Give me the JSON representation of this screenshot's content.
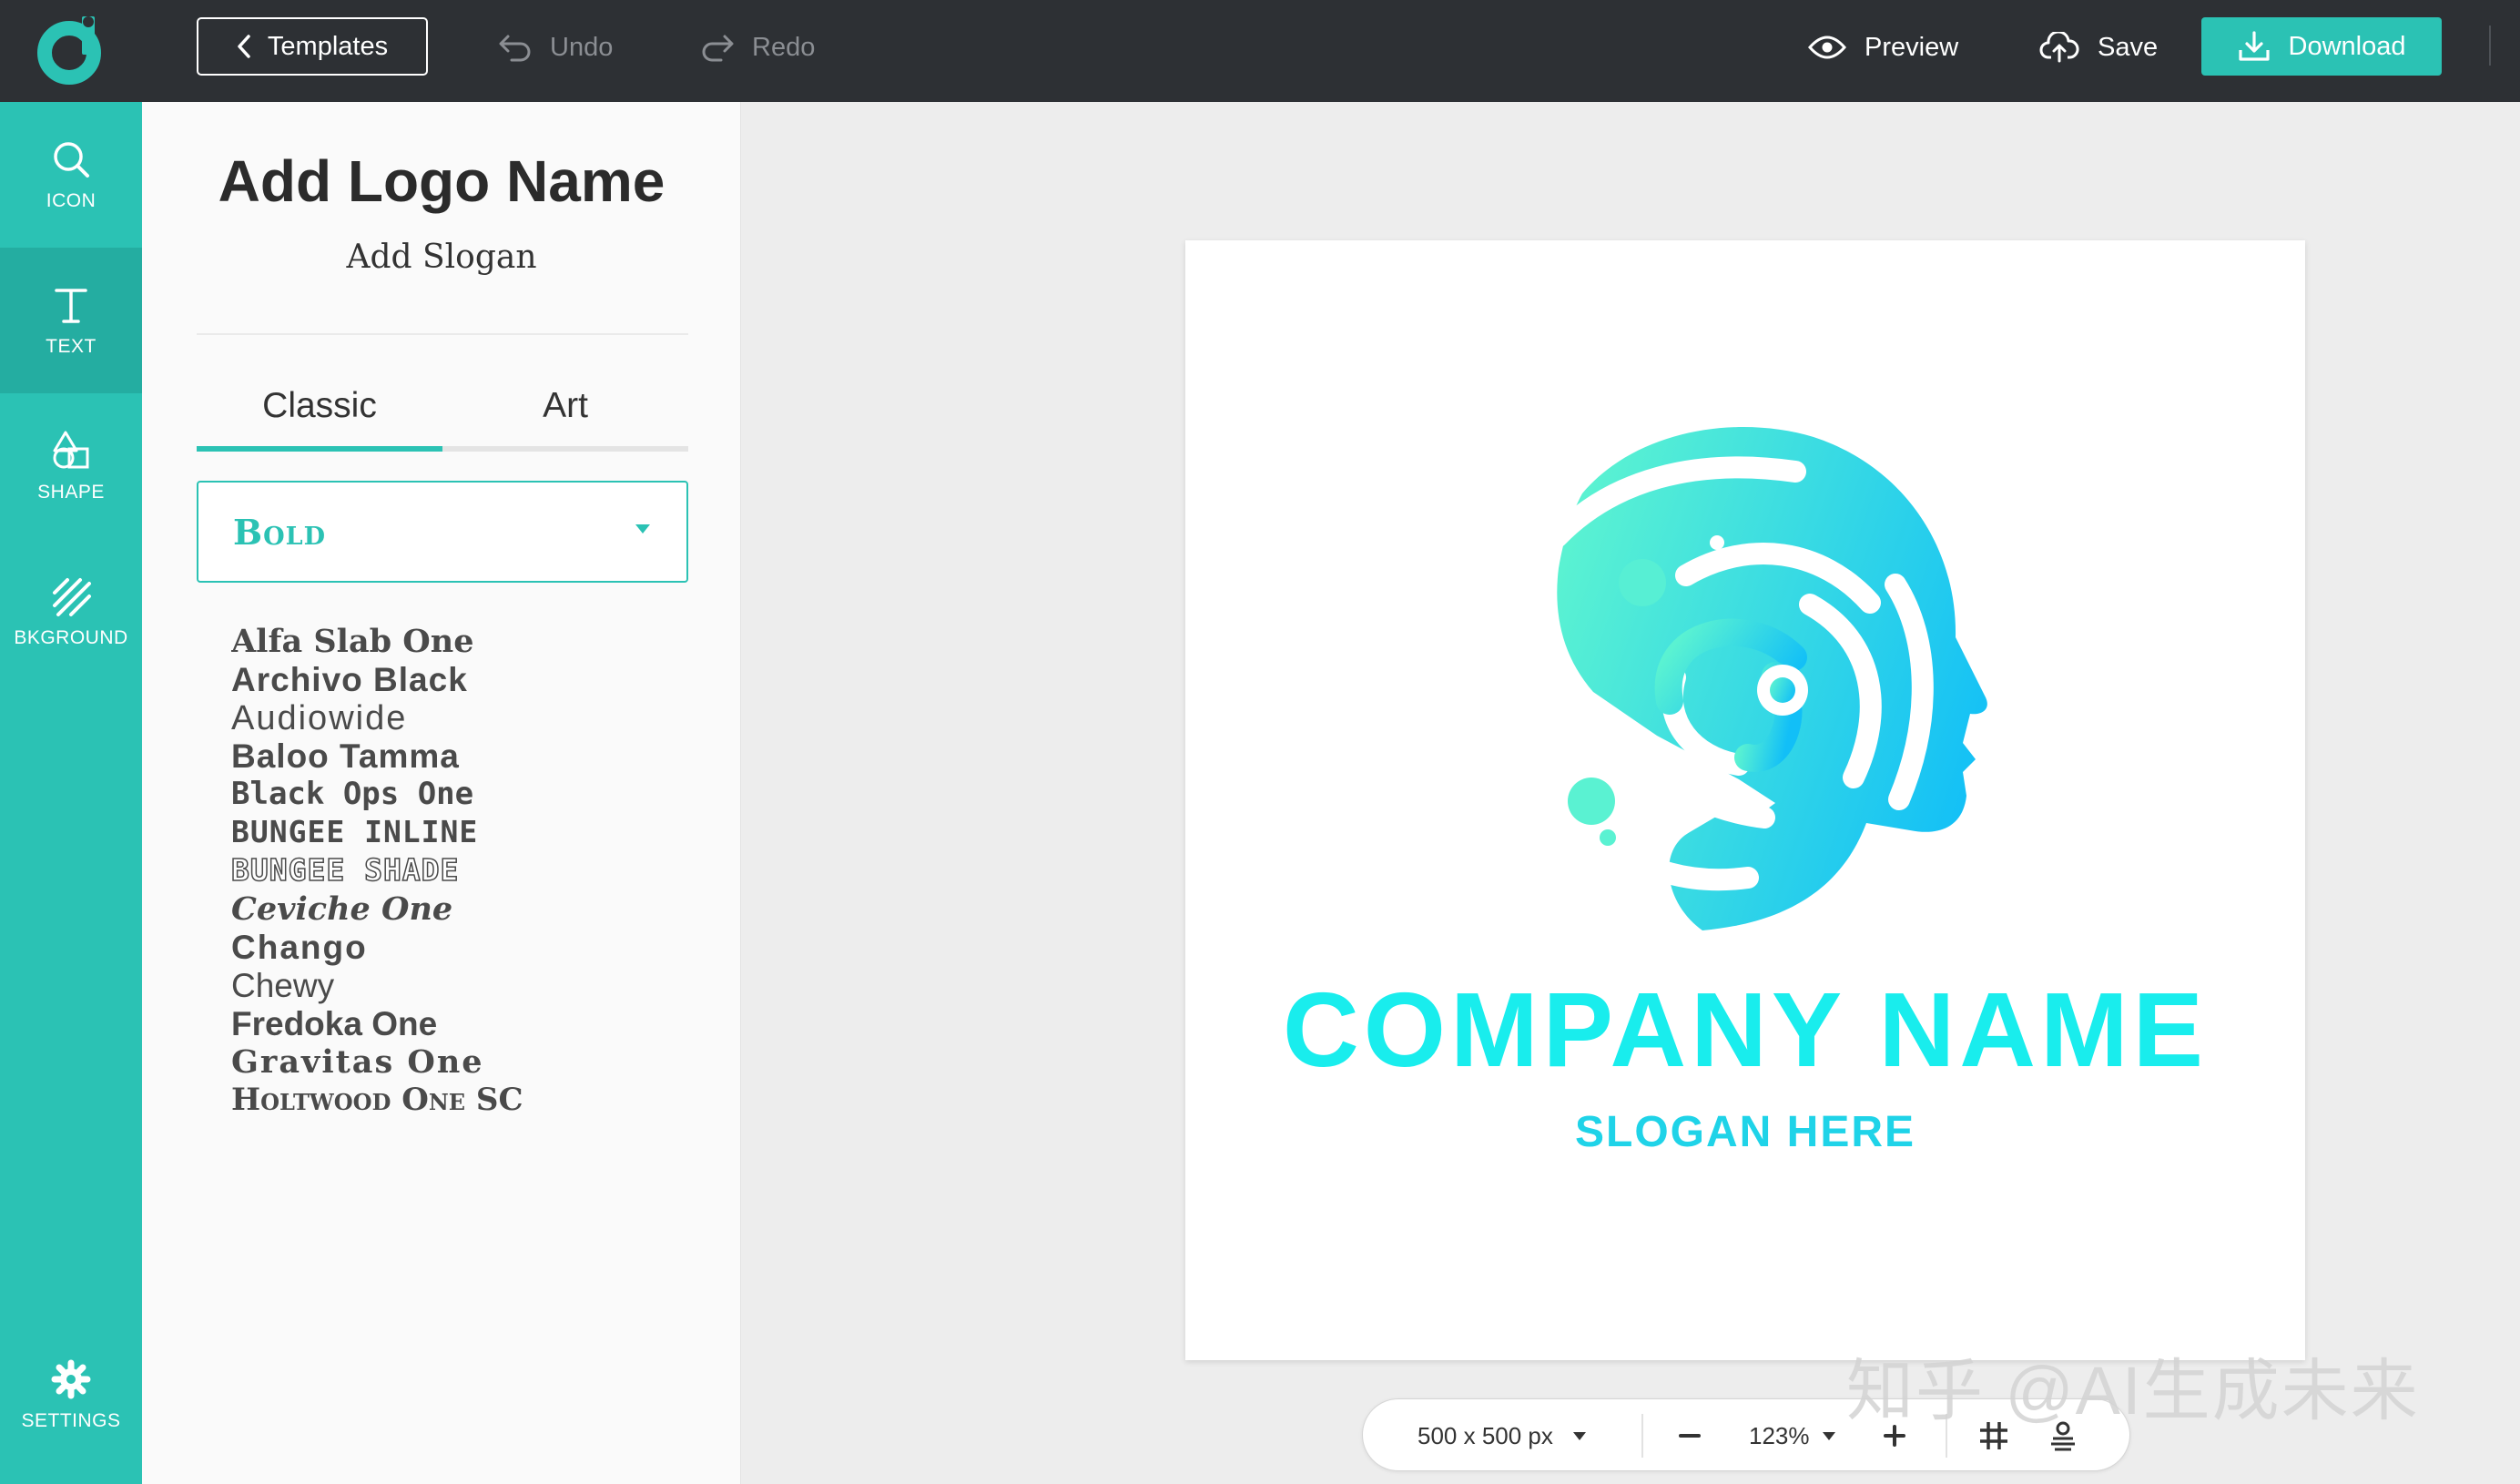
{
  "toolbar": {
    "templates_label": "Templates",
    "undo_label": "Undo",
    "redo_label": "Redo",
    "preview_label": "Preview",
    "save_label": "Save",
    "download_label": "Download"
  },
  "sidebar": {
    "items": [
      {
        "label": "ICON",
        "icon": "search-icon"
      },
      {
        "label": "TEXT",
        "icon": "text-icon"
      },
      {
        "label": "SHAPE",
        "icon": "shapes-icon"
      },
      {
        "label": "BKGROUND",
        "icon": "background-stripes-icon"
      }
    ],
    "settings_label": "SETTINGS",
    "active": "TEXT"
  },
  "panel": {
    "title": "Add Logo Name",
    "slogan": "Add Slogan",
    "tabs": [
      {
        "label": "Classic",
        "active": true
      },
      {
        "label": "Art",
        "active": false
      }
    ],
    "font_category": "Bold",
    "fonts": [
      "Alfa Slab One",
      "Archivo Black",
      "Audiowide",
      "Baloo Tamma",
      "Black Ops One",
      "BUNGEE INLINE",
      "BUNGEE SHADE",
      "Ceviche One",
      "Chango",
      "Chewy",
      "Fredoka One",
      "Gravitas One",
      "Holtwood One SC"
    ]
  },
  "canvas": {
    "company_name": "COMPANY NAME",
    "slogan": "SLOGAN HERE",
    "name_color": "#19EDED",
    "gradient_start": "#5AF2D2",
    "gradient_end": "#12BFF7"
  },
  "bottom_bar": {
    "canvas_size": "500 x 500 px",
    "zoom": "123%"
  },
  "watermark": "知乎 @AI生成未来",
  "colors": {
    "accent": "#2BC2B4",
    "topbar": "#2D3034"
  }
}
